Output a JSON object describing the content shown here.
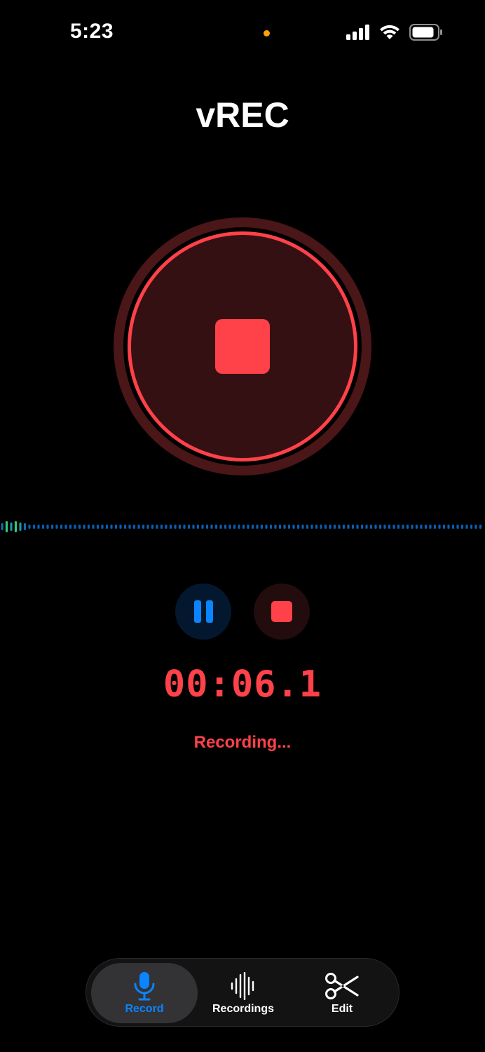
{
  "status_bar": {
    "time": "5:23",
    "privacy_indicator_color": "#ff9f0a",
    "icons": [
      "cellular-signal-icon",
      "wifi-icon",
      "battery-icon"
    ]
  },
  "app": {
    "title": "vREC"
  },
  "record_button": {
    "icon": "stop-icon",
    "accent_color": "#ff4149"
  },
  "controls": {
    "pause_icon": "pause-icon",
    "stop_icon": "stop-icon"
  },
  "timer": {
    "elapsed": "00:06.1",
    "status": "Recording..."
  },
  "tab_bar": {
    "active_tab": "record",
    "tabs": [
      {
        "id": "record",
        "label": "Record",
        "icon": "microphone-icon"
      },
      {
        "id": "recordings",
        "label": "Recordings",
        "icon": "waveform-icon"
      },
      {
        "id": "edit",
        "label": "Edit",
        "icon": "scissors-icon"
      }
    ]
  },
  "colors": {
    "accent_red": "#ff4149",
    "accent_blue": "#0a84ff",
    "waveform_idle": "#0a5fb0",
    "waveform_active": "#2ecc71"
  }
}
